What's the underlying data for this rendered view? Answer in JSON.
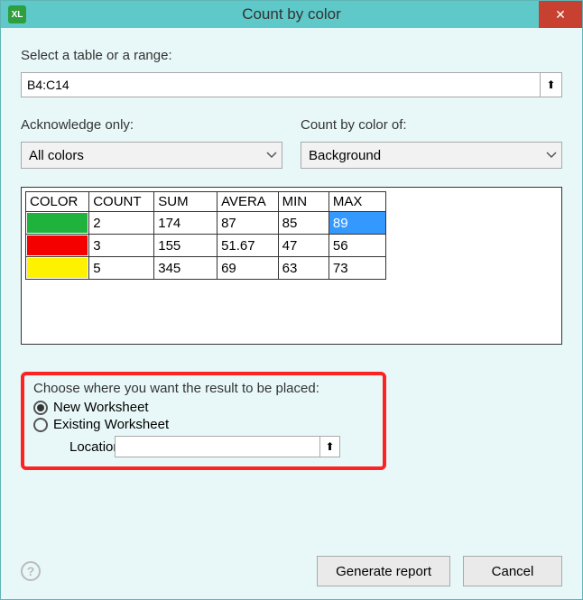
{
  "title": "Count by color",
  "appIcon": "XL",
  "labels": {
    "selectRange": "Select a table or a range:",
    "acknowledge": "Acknowledge only:",
    "countBy": "Count by color of:",
    "choose": "Choose where you want the result to be placed:",
    "newWs": "New Worksheet",
    "existWs": "Existing Worksheet",
    "location": "Location"
  },
  "range": "B4:C14",
  "ackValue": "All colors",
  "countByValue": "Background",
  "chart_data": {
    "type": "table",
    "headers": [
      "COLOR",
      "COUNT",
      "SUM",
      "AVERA",
      "MIN",
      "MAX"
    ],
    "rows": [
      {
        "color": "#1fb23c",
        "count": "2",
        "sum": "174",
        "avg": "87",
        "min": "85",
        "max": "89",
        "maxSelected": true
      },
      {
        "color": "#f50000",
        "count": "3",
        "sum": "155",
        "avg": "51.67",
        "min": "47",
        "max": "56",
        "maxSelected": false
      },
      {
        "color": "#fff200",
        "count": "5",
        "sum": "345",
        "avg": "69",
        "min": "63",
        "max": "73",
        "maxSelected": false
      }
    ]
  },
  "placement": {
    "newChecked": true,
    "existChecked": false,
    "locationValue": ""
  },
  "buttons": {
    "generate": "Generate report",
    "cancel": "Cancel"
  }
}
